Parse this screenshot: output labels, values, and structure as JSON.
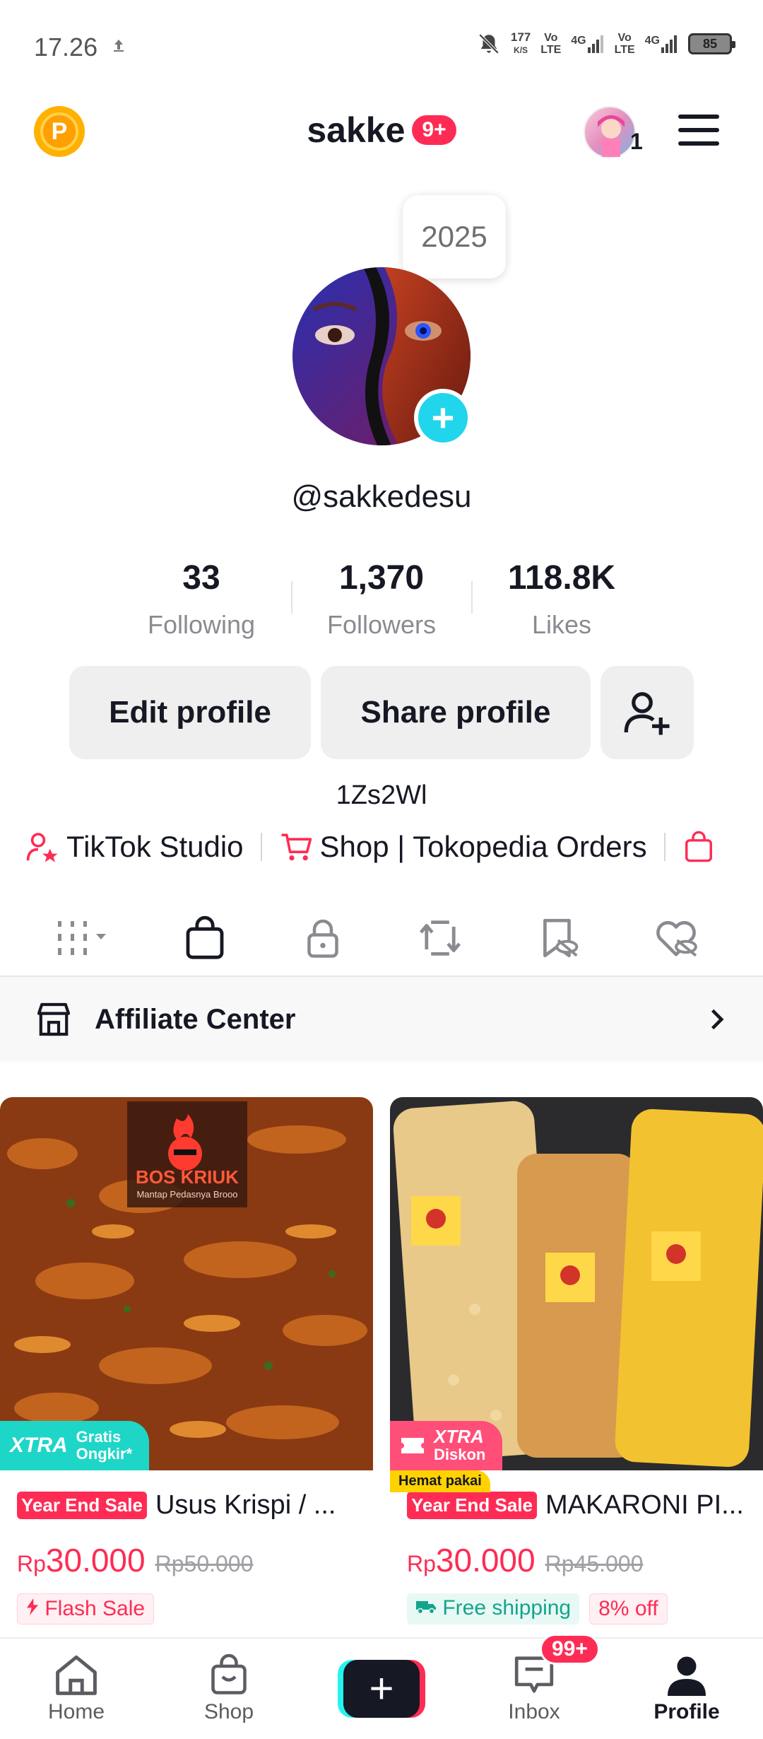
{
  "status_bar": {
    "time": "17.26",
    "net_speed_value": "177",
    "net_speed_unit": "K/S",
    "volte_label_top": "Vo",
    "volte_label_bottom": "LTE",
    "network_type": "4G",
    "battery": "85"
  },
  "header": {
    "coin_letter": "P",
    "title": "sakke",
    "notification_badge": "9+",
    "avatar_count": "1"
  },
  "profile": {
    "bubble_text": "2025",
    "username": "@sakkedesu",
    "stats": [
      {
        "value": "33",
        "label": "Following"
      },
      {
        "value": "1,370",
        "label": "Followers"
      },
      {
        "value": "118.8K",
        "label": "Likes"
      }
    ],
    "edit_label": "Edit profile",
    "share_label": "Share profile",
    "bio": "1Zs2Wl"
  },
  "links": {
    "studio": "TikTok Studio",
    "shop": "Shop | Tokopedia Orders"
  },
  "affiliate": {
    "label": "Affiliate Center"
  },
  "products": [
    {
      "badge_big": "XTRA",
      "badge_small_1": "Gratis",
      "badge_small_2": "Ongkir*",
      "sale_tag": "Year End Sale",
      "title": "Usus Krispi / ...",
      "currency": "Rp",
      "price": "30.000",
      "old_price": "Rp50.000",
      "chip": "Flash Sale",
      "image_brand": "BOS KRIUK",
      "image_tagline": "Mantap Pedasnya Brooo"
    },
    {
      "badge_big": "XTRA",
      "badge_small_1": "Diskon",
      "hemat_label": "Hemat pakai",
      "sale_tag": "Year End Sale",
      "title": "MAKARONI PI...",
      "currency": "Rp",
      "price": "30.000",
      "old_price": "Rp45.000",
      "chip_shipping": "Free shipping",
      "chip_discount": "8% off"
    }
  ],
  "bottom_nav": {
    "home": "Home",
    "shop": "Shop",
    "create": "+",
    "inbox": "Inbox",
    "inbox_badge": "99+",
    "profile": "Profile"
  },
  "colors": {
    "accent": "#fe2c55",
    "cyan": "#20d5ec",
    "text": "#161823",
    "muted": "#8a8b91"
  }
}
